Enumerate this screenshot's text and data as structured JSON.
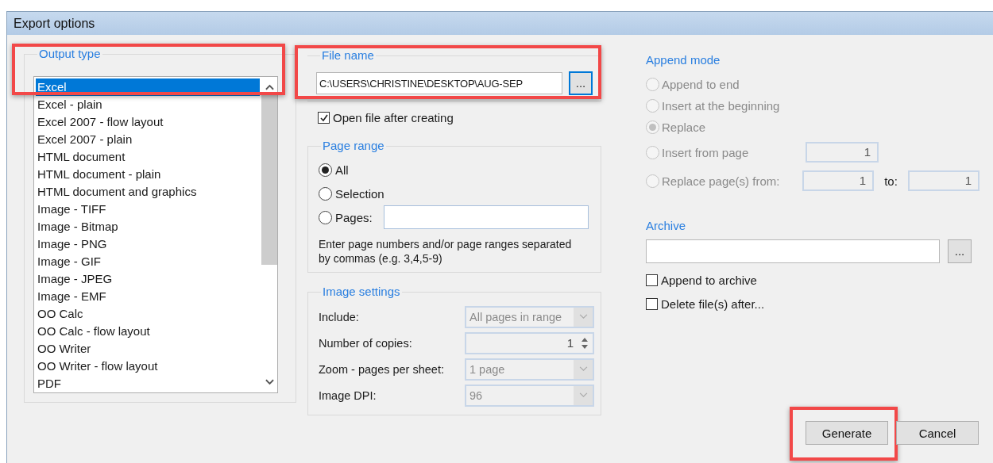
{
  "window": {
    "title": "Export options"
  },
  "output_type": {
    "label": "Output type",
    "highlighted": true,
    "items": [
      {
        "label": "Excel",
        "selected": true
      },
      {
        "label": "Excel - plain",
        "selected": false
      },
      {
        "label": "Excel 2007 - flow layout",
        "selected": false
      },
      {
        "label": "Excel 2007 - plain",
        "selected": false
      },
      {
        "label": "HTML document",
        "selected": false
      },
      {
        "label": "HTML document - plain",
        "selected": false
      },
      {
        "label": "HTML document and graphics",
        "selected": false
      },
      {
        "label": "Image - TIFF",
        "selected": false
      },
      {
        "label": "Image - Bitmap",
        "selected": false
      },
      {
        "label": "Image - PNG",
        "selected": false
      },
      {
        "label": "Image - GIF",
        "selected": false
      },
      {
        "label": "Image - JPEG",
        "selected": false
      },
      {
        "label": "Image - EMF",
        "selected": false
      },
      {
        "label": "OO Calc",
        "selected": false
      },
      {
        "label": "OO Calc - flow layout",
        "selected": false
      },
      {
        "label": "OO Writer",
        "selected": false
      },
      {
        "label": "OO Writer - flow layout",
        "selected": false
      },
      {
        "label": "PDF",
        "selected": false
      }
    ]
  },
  "file_name": {
    "label": "File name",
    "highlighted": true,
    "value": "C:\\USERS\\CHRISTINE\\DESKTOP\\AUG-SEP",
    "browse": "...",
    "browse_focused": true
  },
  "open_after": {
    "label": "Open file after creating",
    "checked": true
  },
  "page_range": {
    "label": "Page range",
    "options": [
      {
        "label": "All",
        "selected": true,
        "kind": "plain"
      },
      {
        "label": "Selection",
        "selected": false,
        "kind": "plain"
      },
      {
        "label": "Pages:",
        "selected": false,
        "kind": "field"
      }
    ],
    "note": "Enter page numbers and/or page ranges separated by commas (e.g. 3,4,5-9)"
  },
  "image_settings": {
    "label": "Image settings",
    "rows": [
      {
        "label": "Include:",
        "kind": "dropdown",
        "value": "All pages in range",
        "disabled": true
      },
      {
        "label": "Number of copies:",
        "kind": "spinner",
        "value": "1",
        "disabled": true
      },
      {
        "label": "Zoom - pages per sheet:",
        "kind": "dropdown",
        "value": "1 page",
        "disabled": true
      },
      {
        "label": "Image DPI:",
        "kind": "dropdown",
        "value": "96",
        "disabled": true
      }
    ]
  },
  "append_mode": {
    "label": "Append mode",
    "disabled": true,
    "options": [
      {
        "label": "Append to end",
        "selected": false,
        "kind": "plain"
      },
      {
        "label": "Insert at the beginning",
        "selected": false,
        "kind": "plain"
      },
      {
        "label": "Replace",
        "selected": true,
        "kind": "plain"
      },
      {
        "label": "Insert from page",
        "selected": false,
        "kind": "from",
        "from": "1"
      },
      {
        "label": "Replace page(s) from:",
        "selected": false,
        "kind": "range",
        "from": "1",
        "to_label": "to:",
        "to": "1"
      }
    ]
  },
  "archive": {
    "label": "Archive",
    "browse": "...",
    "options": [
      {
        "label": "Append to archive",
        "checked": false
      },
      {
        "label": "Delete file(s) after...",
        "checked": false
      }
    ]
  },
  "buttons": [
    {
      "label": "Generate",
      "highlighted": true
    },
    {
      "label": "Cancel",
      "highlighted": false
    }
  ]
}
